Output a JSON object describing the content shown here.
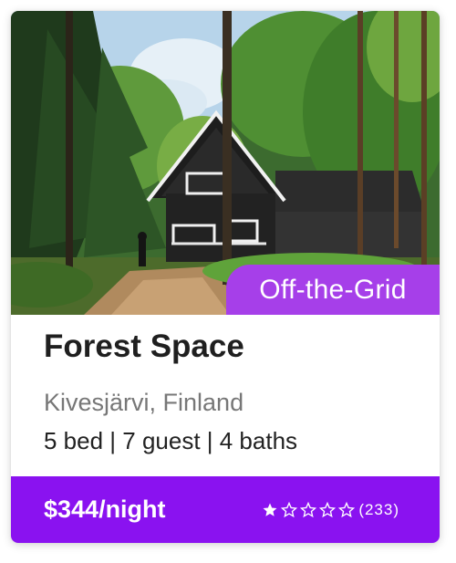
{
  "listing": {
    "badge": "Off-the-Grid",
    "title": "Forest Space",
    "location": "Kivesjärvi, Finland",
    "details": "5 bed | 7 guest | 4 baths",
    "price": "$344/night",
    "rating": {
      "value": 1,
      "max": 5,
      "count_text": "(233)"
    }
  },
  "colors": {
    "badge": "#a63fe9",
    "footer": "#8a12f0",
    "title": "#1f1f1f",
    "location": "#777777"
  },
  "photo": {
    "icon": "forest-cabin-photo"
  }
}
